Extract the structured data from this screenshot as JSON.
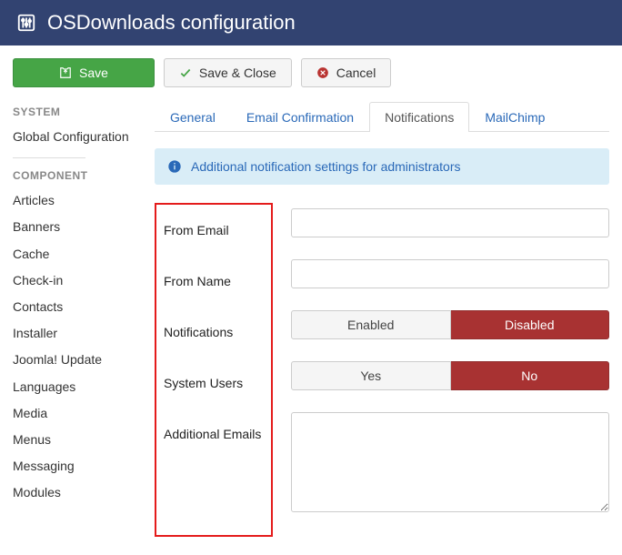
{
  "header": {
    "title": "OSDownloads configuration"
  },
  "toolbar": {
    "save": "Save",
    "save_close": "Save & Close",
    "cancel": "Cancel"
  },
  "sidebar": {
    "heading_system": "SYSTEM",
    "global_config": "Global Configuration",
    "heading_component": "COMPONENT",
    "items": [
      "Articles",
      "Banners",
      "Cache",
      "Check-in",
      "Contacts",
      "Installer",
      "Joomla! Update",
      "Languages",
      "Media",
      "Menus",
      "Messaging",
      "Modules"
    ]
  },
  "tabs": {
    "general": "General",
    "email": "Email Confirmation",
    "notifications": "Notifications",
    "mailchimp": "MailChimp"
  },
  "info": "Additional notification settings for administrators",
  "form": {
    "from_email_label": "From Email",
    "from_name_label": "From Name",
    "notifications_label": "Notifications",
    "system_users_label": "System Users",
    "additional_emails_label": "Additional Emails",
    "enabled": "Enabled",
    "disabled": "Disabled",
    "yes": "Yes",
    "no": "No",
    "from_email_value": "",
    "from_name_value": "",
    "additional_emails_value": ""
  }
}
